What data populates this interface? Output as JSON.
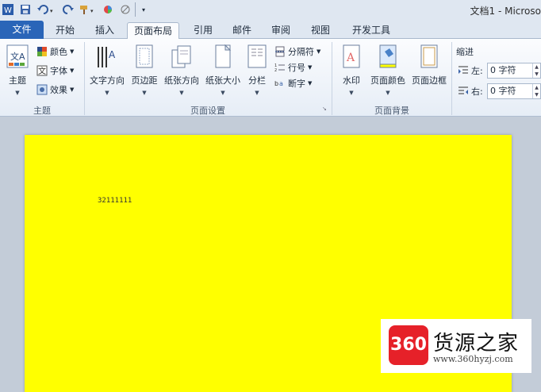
{
  "window": {
    "title": "文档1 - Microso"
  },
  "tabs": [
    {
      "label": "文件"
    },
    {
      "label": "开始"
    },
    {
      "label": "插入"
    },
    {
      "label": "页面布局"
    },
    {
      "label": "引用"
    },
    {
      "label": "邮件"
    },
    {
      "label": "审阅"
    },
    {
      "label": "视图"
    },
    {
      "label": "开发工具"
    }
  ],
  "ribbon": {
    "theme_group": {
      "label": "主题",
      "theme_button": "主题",
      "colors": "颜色",
      "fonts": "字体",
      "effects": "效果"
    },
    "page_setup_group": {
      "label": "页面设置",
      "text_direction": "文字方向",
      "margins": "页边距",
      "orientation": "纸张方向",
      "size": "纸张大小",
      "columns": "分栏",
      "breaks": "分隔符",
      "line_numbers": "行号",
      "hyphenation": "断字"
    },
    "page_background_group": {
      "label": "页面背景",
      "watermark": "水印",
      "page_color": "页面颜色",
      "page_borders": "页面边框"
    },
    "paragraph_group": {
      "indent_title": "缩进",
      "left_label": "左:",
      "left_value": "0 字符",
      "right_label": "右:",
      "right_value": "0 字符"
    }
  },
  "document": {
    "page_color": "#ffff00",
    "text": "32111111"
  },
  "watermark_overlay": {
    "logo_text": "360",
    "name": "货源之家",
    "url": "www.360hyzj.com"
  },
  "colors": {
    "file_tab": "#2a65b8",
    "ribbon_bg": "#fbfcfe",
    "doc_background": "#c3ccd8"
  }
}
